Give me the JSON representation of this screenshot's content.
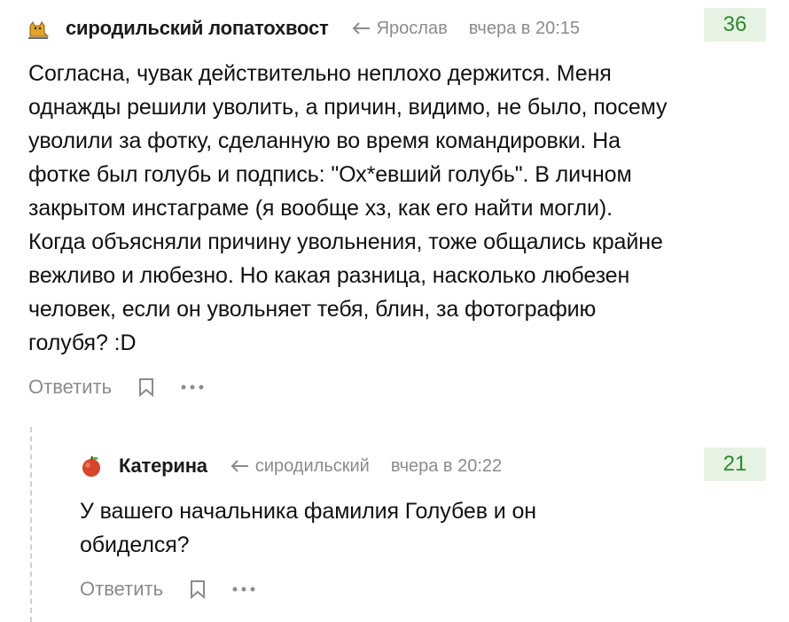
{
  "comments": [
    {
      "author": "сиродильский лопатохвост",
      "reply_to": "Ярослав",
      "time": "вчера в 20:15",
      "rating": "36",
      "text": "Согласна, чувак действительно неплохо держится. Меня однажды решили уволить, а причин, видимо, не было, посему уволили за фотку, сделанную во время командировки. На фотке был голубь и подпись: \"Ох*евший голубь\". В личном закрытом инстаграме (я вообще хз, как его найти могли). Когда объясняли причину увольнения, тоже общались крайне вежливо и любезно. Но какая разница, насколько любезен человек, если он увольняет тебя, блин, за фотографию голубя? :D",
      "reply_label": "Ответить"
    },
    {
      "author": "Катерина",
      "reply_to": "сиродильский",
      "time": "вчера в 20:22",
      "rating": "21",
      "text": "У вашего начальника фамилия Голубев и он обиделся?",
      "reply_label": "Ответить"
    }
  ],
  "icons": {
    "avatar_1": "cat-avatar-icon",
    "avatar_2": "apple-avatar-icon",
    "reply_arrow": "reply-arrow-icon",
    "bookmark": "bookmark-icon",
    "more": "more-dots-icon"
  },
  "colors": {
    "rating_bg": "#e6f3e3",
    "rating_text": "#2b8a2b",
    "meta_text": "#8b8b8b"
  }
}
